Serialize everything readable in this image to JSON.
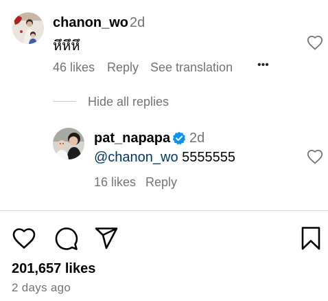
{
  "comment": {
    "username": "chanon_wo",
    "time": "2d",
    "text": "หึหึหึ",
    "likes": "46 likes",
    "reply_label": "Reply",
    "translate_label": "See translation",
    "more_label": "•••"
  },
  "replies_toggle": {
    "label": "Hide all replies"
  },
  "reply": {
    "username": "pat_napapa",
    "time": "2d",
    "mention": "@chanon_wo",
    "text": " 5555555",
    "likes": "16 likes",
    "reply_label": "Reply"
  },
  "post": {
    "likes": "201,657 likes",
    "date": "2 days ago"
  },
  "colors": {
    "secondary_text": "#737373",
    "mention": "#00376b",
    "verified": "#0095f6"
  }
}
